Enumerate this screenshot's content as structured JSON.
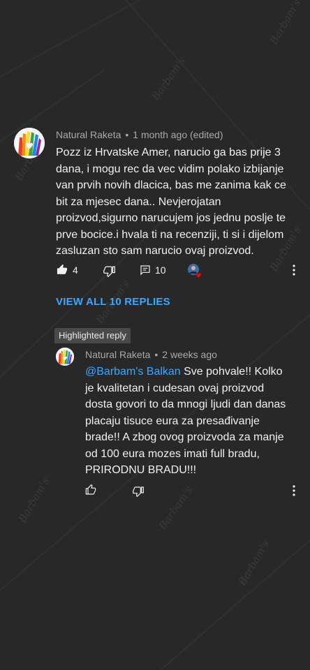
{
  "comment": {
    "author": "Natural Raketa",
    "time": "1 month ago (edited)",
    "text": "Pozz iz Hrvatske Amer, narucio ga bas prije 3 dana, i mogu rec da vec vidim polako izbijanje van prvih novih dlacica, bas me zanima kak ce bit za mjesec dana.. Nevjerojatan proizvod,sigurno narucujem jos jednu poslje te prve bocice.i hvala ti na recenziji, ti si i dijelom zasluzan sto sam narucio ovaj proizvod.",
    "likes": "4",
    "replies_count": "10",
    "view_replies_label": "VIEW ALL 10 REPLIES"
  },
  "reply": {
    "badge": "Highlighted reply",
    "author": "Natural Raketa",
    "time": "2 weeks ago",
    "mention": "@Barbam's Balkan",
    "text": " Sve pohvale!! Kolko je kvalitetan i cudesan ovaj proizvod dosta govori to da mnogi ljudi dan danas placaju tisuce eura za presađivanje brade!!  A zbog ovog proizvoda za manje od 100 eura mozes imati full bradu, PRIRODNU BRADU!!!"
  },
  "icons": {
    "like": "thumbs-up-icon",
    "dislike": "thumbs-down-icon",
    "reply": "comment-icon",
    "heart": "creator-heart-icon",
    "more": "more-vert-icon"
  },
  "colors": {
    "background": "#282828",
    "link": "#3ea6ff",
    "meta": "#aaaaaa",
    "heart": "#ff0000"
  }
}
